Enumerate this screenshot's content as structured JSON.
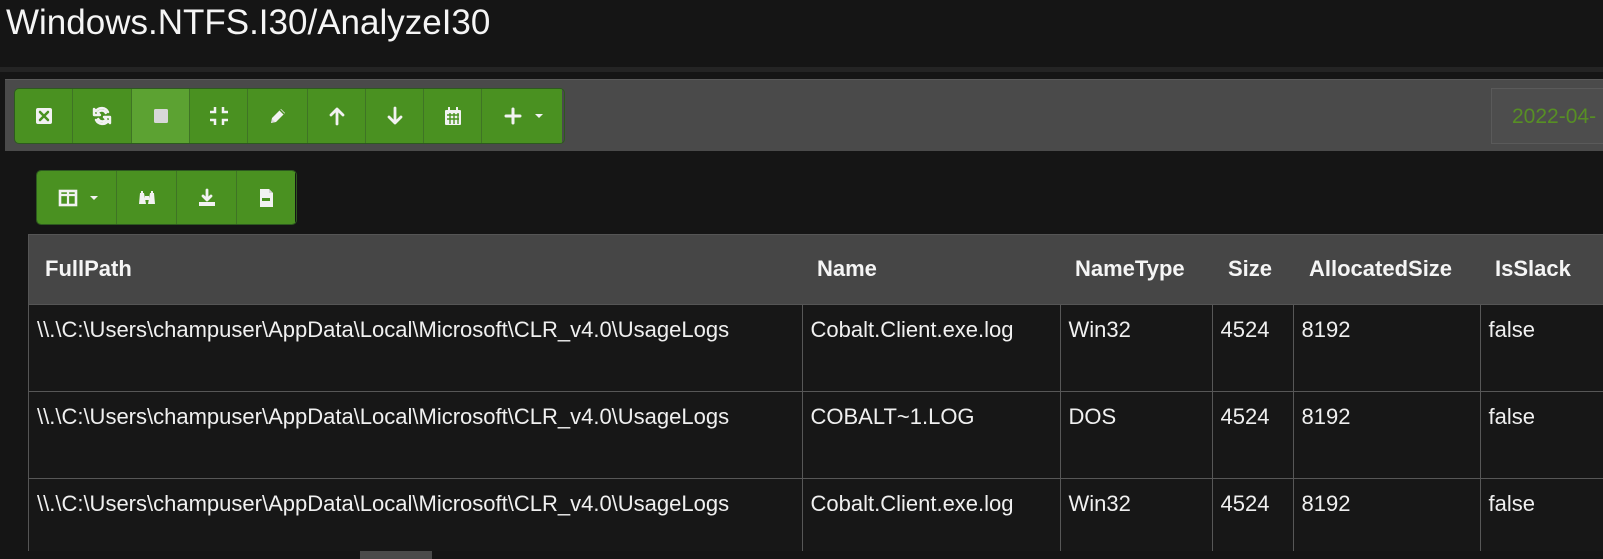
{
  "page": {
    "title": "Windows.NTFS.I30/AnalyzeI30"
  },
  "toolbar": {
    "main_buttons": [
      {
        "name": "clear",
        "icon": "close-square-icon"
      },
      {
        "name": "refresh",
        "icon": "refresh-icon"
      },
      {
        "name": "stop",
        "icon": "stop-icon"
      },
      {
        "name": "compress",
        "icon": "compress-icon"
      },
      {
        "name": "edit",
        "icon": "pencil-icon"
      },
      {
        "name": "move-up",
        "icon": "arrow-up-icon"
      },
      {
        "name": "move-down",
        "icon": "arrow-down-icon"
      },
      {
        "name": "calendar",
        "icon": "calendar-icon"
      },
      {
        "name": "add-menu",
        "icon": "plus-icon"
      }
    ],
    "timestamp_value": "2022-04-"
  },
  "table_tools": {
    "buttons": [
      {
        "name": "columns",
        "icon": "columns-icon"
      },
      {
        "name": "search",
        "icon": "binoculars-icon"
      },
      {
        "name": "download",
        "icon": "download-icon"
      },
      {
        "name": "csv",
        "icon": "csv-file-icon"
      }
    ]
  },
  "table": {
    "columns": [
      "FullPath",
      "Name",
      "NameType",
      "Size",
      "AllocatedSize",
      "IsSlack"
    ],
    "rows": [
      {
        "FullPath": "\\\\.\\C:\\Users\\champuser\\AppData\\Local\\Microsoft\\CLR_v4.0\\UsageLogs",
        "Name": "Cobalt.Client.exe.log",
        "NameType": "Win32",
        "Size": "4524",
        "AllocatedSize": "8192",
        "IsSlack": "false"
      },
      {
        "FullPath": "\\\\.\\C:\\Users\\champuser\\AppData\\Local\\Microsoft\\CLR_v4.0\\UsageLogs",
        "Name": "COBALT~1.LOG",
        "NameType": "DOS",
        "Size": "4524",
        "AllocatedSize": "8192",
        "IsSlack": "false"
      },
      {
        "FullPath": "\\\\.\\C:\\Users\\champuser\\AppData\\Local\\Microsoft\\CLR_v4.0\\UsageLogs",
        "Name": "Cobalt.Client.exe.log",
        "NameType": "Win32",
        "Size": "4524",
        "AllocatedSize": "8192",
        "IsSlack": "false"
      }
    ]
  },
  "colors": {
    "background": "#151515",
    "toolbar": "#4a4a4a",
    "button_green": "#4a9121",
    "header_gray": "#464646",
    "text": "#f0f0f0",
    "timestamp_green": "#578f24"
  }
}
